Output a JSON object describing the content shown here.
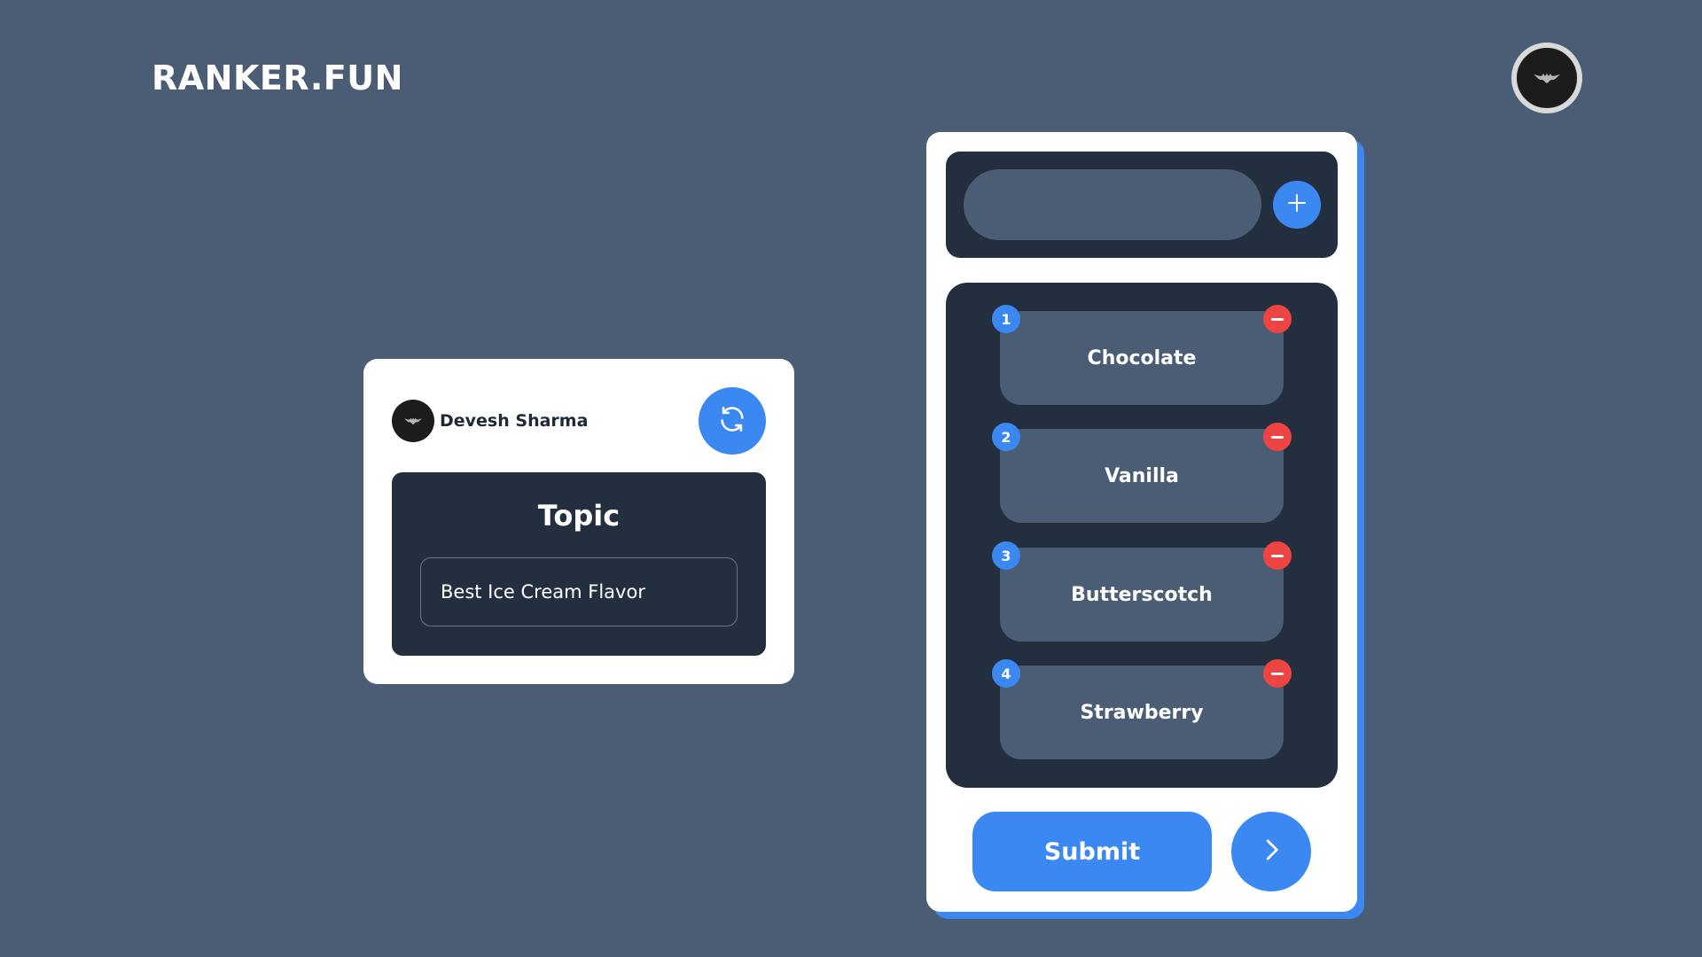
{
  "app": {
    "logo": "RANKER.FUN"
  },
  "header": {
    "avatar_icon": "bat-icon"
  },
  "topic_card": {
    "user_name": "Devesh Sharma",
    "refresh_icon": "refresh-icon",
    "topic_heading": "Topic",
    "topic_value": "Best Ice Cream Flavor"
  },
  "ranking": {
    "input_value": "",
    "add_icon": "plus-icon",
    "items": [
      {
        "rank": "1",
        "label": "Chocolate"
      },
      {
        "rank": "2",
        "label": "Vanilla"
      },
      {
        "rank": "3",
        "label": "Butterscotch"
      },
      {
        "rank": "4",
        "label": "Strawberry"
      }
    ],
    "submit_label": "Submit",
    "next_icon": "chevron-right-icon"
  },
  "colors": {
    "background": "#4b5d74",
    "accent": "#3b88f2",
    "dark_panel": "#232f3e",
    "remove": "#ef4444"
  }
}
